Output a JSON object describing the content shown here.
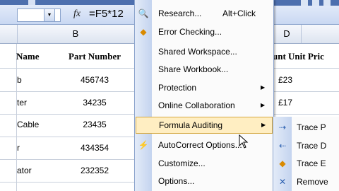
{
  "formula_bar": {
    "fx": "fx",
    "formula": "=F5*12"
  },
  "columns": [
    "B",
    "D"
  ],
  "sheet": {
    "header_name": "Name",
    "header_part": "Part Number",
    "header_price": "unt Unit Pric",
    "rows": [
      {
        "name": "b",
        "part": "456743",
        "price": "£23"
      },
      {
        "name": "ter",
        "part": "34235",
        "price": "£17"
      },
      {
        "name": "Cable",
        "part": "23435",
        "price": ""
      },
      {
        "name": "r",
        "part": "434354",
        "price": ""
      },
      {
        "name": "ator",
        "part": "232352",
        "price": ""
      }
    ]
  },
  "menu": {
    "items": [
      {
        "label": "Research...",
        "shortcut": "Alt+Click",
        "icon": "research-icon"
      },
      {
        "label": "Error Checking...",
        "icon": "error-checking-icon"
      },
      {
        "label": "Shared Workspace..."
      },
      {
        "label": "Share Workbook..."
      },
      {
        "label": "Protection",
        "submenu": true
      },
      {
        "label": "Online Collaboration",
        "submenu": true
      },
      {
        "label": "Formula Auditing",
        "submenu": true,
        "highlighted": true
      },
      {
        "label": "AutoCorrect Options...",
        "icon": "autocorrect-icon"
      },
      {
        "label": "Customize..."
      },
      {
        "label": "Options..."
      }
    ]
  },
  "submenu": {
    "items": [
      {
        "label": "Trace P",
        "icon": "trace-precedents-icon"
      },
      {
        "label": "Trace D",
        "icon": "trace-dependents-icon"
      },
      {
        "label": "Trace E",
        "icon": "trace-error-icon"
      },
      {
        "label": "Remove",
        "icon": "remove-arrows-icon"
      }
    ]
  },
  "colors": {
    "menu_highlight": "#ffeec2",
    "menu_highlight_border": "#d4a73f",
    "toolbar_blue": "#4d6fae"
  }
}
